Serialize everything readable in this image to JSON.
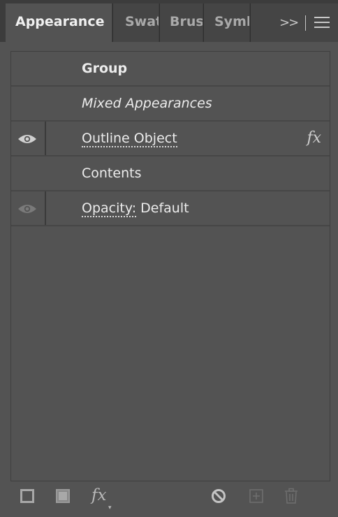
{
  "tabs": [
    {
      "label": "Appearance",
      "active": true
    },
    {
      "label": "Swat",
      "active": false
    },
    {
      "label": "Brus",
      "active": false
    },
    {
      "label": "Symb",
      "active": false
    }
  ],
  "overflow_label": ">>",
  "rows": {
    "group": {
      "label": "Group"
    },
    "mixed": {
      "label": "Mixed Appearances"
    },
    "outline": {
      "label": "Outline Object",
      "fx": "fx"
    },
    "contents": {
      "label": "Contents"
    },
    "opacity": {
      "label": "Opacity:",
      "value": " Default"
    }
  },
  "toolbar": {
    "fx_label": "fx",
    "fx_caret": "▾"
  },
  "icons": {
    "tab_menu": "hamburger-menu-icon",
    "visibility": "eye-icon",
    "add_stroke": "square-outline-icon",
    "add_fill": "square-filled-icon",
    "clear": "no-symbol-icon",
    "duplicate": "plus-square-icon",
    "delete": "trash-icon"
  },
  "colors": {
    "panel_bg": "#535353",
    "tabbar_bg": "#3c3c3c",
    "text": "#ececec"
  }
}
